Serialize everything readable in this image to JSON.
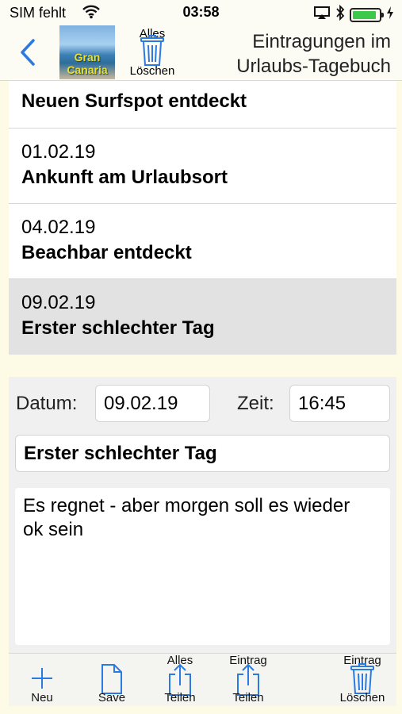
{
  "status_bar": {
    "carrier": "SIM fehlt",
    "time": "03:58",
    "battery_level": 0.9,
    "colors": {
      "battery": "#3cc84a"
    }
  },
  "nav": {
    "back_icon": "chevron-left-icon",
    "thumbnail_line1": "Gran",
    "thumbnail_line2": "Canaria",
    "trash_top": "Alles",
    "trash_bottom": "Löschen",
    "title_line1": "Eintragungen im",
    "title_line2": "Urlaubs-Tagebuch"
  },
  "entries": [
    {
      "title": "Neuen Surfspot entdeckt"
    },
    {
      "date": "01.02.19",
      "title": "Ankunft am Urlaubsort"
    },
    {
      "date": "04.02.19",
      "title": "Beachbar entdeckt"
    },
    {
      "date": "09.02.19",
      "title": "Erster schlechter Tag",
      "selected": true
    }
  ],
  "form": {
    "date_label": "Datum:",
    "date_value": "09.02.19",
    "time_label": "Zeit:",
    "time_value": "16:45",
    "title_value": "Erster schlechter Tag",
    "note_line1": "Es regnet - aber morgen soll es wieder",
    "note_line2": "ok sein"
  },
  "toolbar": {
    "new_label": "Neu",
    "save_label": "Save",
    "share_all_top": "Alles",
    "share_all_bottom": "Teilen",
    "share_entry_top": "Eintrag",
    "share_entry_bottom": "Teilen",
    "delete_entry_top": "Eintrag",
    "delete_entry_bottom": "Löschen"
  },
  "colors": {
    "accent": "#2a7ae2",
    "background": "#fdfbe6",
    "selected_row": "#e2e2e2"
  }
}
